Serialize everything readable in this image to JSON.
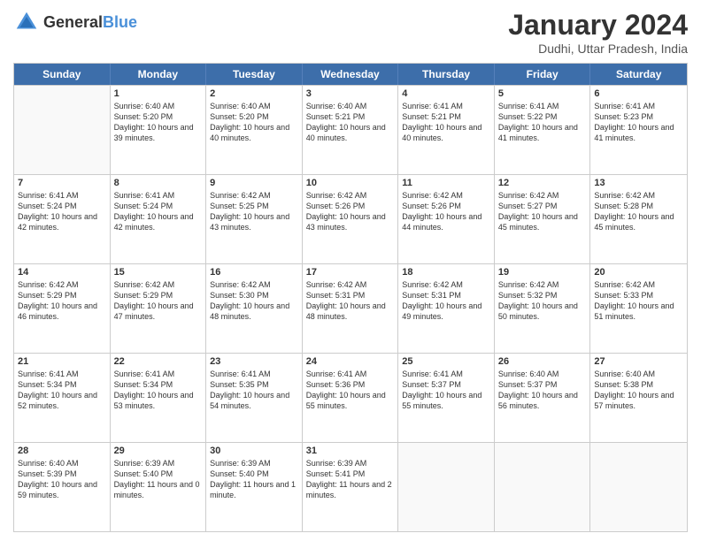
{
  "header": {
    "logo_general": "General",
    "logo_blue": "Blue",
    "month": "January 2024",
    "location": "Dudhi, Uttar Pradesh, India"
  },
  "days_of_week": [
    "Sunday",
    "Monday",
    "Tuesday",
    "Wednesday",
    "Thursday",
    "Friday",
    "Saturday"
  ],
  "weeks": [
    [
      {
        "day": "",
        "info": ""
      },
      {
        "day": "1",
        "info": "Sunrise: 6:40 AM\nSunset: 5:20 PM\nDaylight: 10 hours\nand 39 minutes."
      },
      {
        "day": "2",
        "info": "Sunrise: 6:40 AM\nSunset: 5:20 PM\nDaylight: 10 hours\nand 40 minutes."
      },
      {
        "day": "3",
        "info": "Sunrise: 6:40 AM\nSunset: 5:21 PM\nDaylight: 10 hours\nand 40 minutes."
      },
      {
        "day": "4",
        "info": "Sunrise: 6:41 AM\nSunset: 5:21 PM\nDaylight: 10 hours\nand 40 minutes."
      },
      {
        "day": "5",
        "info": "Sunrise: 6:41 AM\nSunset: 5:22 PM\nDaylight: 10 hours\nand 41 minutes."
      },
      {
        "day": "6",
        "info": "Sunrise: 6:41 AM\nSunset: 5:23 PM\nDaylight: 10 hours\nand 41 minutes."
      }
    ],
    [
      {
        "day": "7",
        "info": "Sunrise: 6:41 AM\nSunset: 5:24 PM\nDaylight: 10 hours\nand 42 minutes."
      },
      {
        "day": "8",
        "info": "Sunrise: 6:41 AM\nSunset: 5:24 PM\nDaylight: 10 hours\nand 42 minutes."
      },
      {
        "day": "9",
        "info": "Sunrise: 6:42 AM\nSunset: 5:25 PM\nDaylight: 10 hours\nand 43 minutes."
      },
      {
        "day": "10",
        "info": "Sunrise: 6:42 AM\nSunset: 5:26 PM\nDaylight: 10 hours\nand 43 minutes."
      },
      {
        "day": "11",
        "info": "Sunrise: 6:42 AM\nSunset: 5:26 PM\nDaylight: 10 hours\nand 44 minutes."
      },
      {
        "day": "12",
        "info": "Sunrise: 6:42 AM\nSunset: 5:27 PM\nDaylight: 10 hours\nand 45 minutes."
      },
      {
        "day": "13",
        "info": "Sunrise: 6:42 AM\nSunset: 5:28 PM\nDaylight: 10 hours\nand 45 minutes."
      }
    ],
    [
      {
        "day": "14",
        "info": "Sunrise: 6:42 AM\nSunset: 5:29 PM\nDaylight: 10 hours\nand 46 minutes."
      },
      {
        "day": "15",
        "info": "Sunrise: 6:42 AM\nSunset: 5:29 PM\nDaylight: 10 hours\nand 47 minutes."
      },
      {
        "day": "16",
        "info": "Sunrise: 6:42 AM\nSunset: 5:30 PM\nDaylight: 10 hours\nand 48 minutes."
      },
      {
        "day": "17",
        "info": "Sunrise: 6:42 AM\nSunset: 5:31 PM\nDaylight: 10 hours\nand 48 minutes."
      },
      {
        "day": "18",
        "info": "Sunrise: 6:42 AM\nSunset: 5:31 PM\nDaylight: 10 hours\nand 49 minutes."
      },
      {
        "day": "19",
        "info": "Sunrise: 6:42 AM\nSunset: 5:32 PM\nDaylight: 10 hours\nand 50 minutes."
      },
      {
        "day": "20",
        "info": "Sunrise: 6:42 AM\nSunset: 5:33 PM\nDaylight: 10 hours\nand 51 minutes."
      }
    ],
    [
      {
        "day": "21",
        "info": "Sunrise: 6:41 AM\nSunset: 5:34 PM\nDaylight: 10 hours\nand 52 minutes."
      },
      {
        "day": "22",
        "info": "Sunrise: 6:41 AM\nSunset: 5:34 PM\nDaylight: 10 hours\nand 53 minutes."
      },
      {
        "day": "23",
        "info": "Sunrise: 6:41 AM\nSunset: 5:35 PM\nDaylight: 10 hours\nand 54 minutes."
      },
      {
        "day": "24",
        "info": "Sunrise: 6:41 AM\nSunset: 5:36 PM\nDaylight: 10 hours\nand 55 minutes."
      },
      {
        "day": "25",
        "info": "Sunrise: 6:41 AM\nSunset: 5:37 PM\nDaylight: 10 hours\nand 55 minutes."
      },
      {
        "day": "26",
        "info": "Sunrise: 6:40 AM\nSunset: 5:37 PM\nDaylight: 10 hours\nand 56 minutes."
      },
      {
        "day": "27",
        "info": "Sunrise: 6:40 AM\nSunset: 5:38 PM\nDaylight: 10 hours\nand 57 minutes."
      }
    ],
    [
      {
        "day": "28",
        "info": "Sunrise: 6:40 AM\nSunset: 5:39 PM\nDaylight: 10 hours\nand 59 minutes."
      },
      {
        "day": "29",
        "info": "Sunrise: 6:39 AM\nSunset: 5:40 PM\nDaylight: 11 hours\nand 0 minutes."
      },
      {
        "day": "30",
        "info": "Sunrise: 6:39 AM\nSunset: 5:40 PM\nDaylight: 11 hours\nand 1 minute."
      },
      {
        "day": "31",
        "info": "Sunrise: 6:39 AM\nSunset: 5:41 PM\nDaylight: 11 hours\nand 2 minutes."
      },
      {
        "day": "",
        "info": ""
      },
      {
        "day": "",
        "info": ""
      },
      {
        "day": "",
        "info": ""
      }
    ]
  ]
}
